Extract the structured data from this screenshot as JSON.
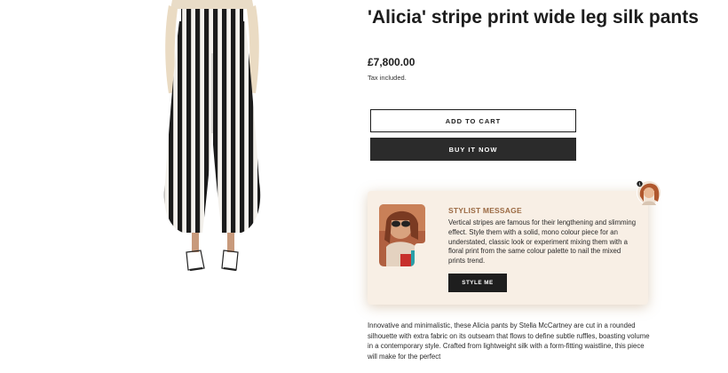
{
  "product": {
    "title": "'Alicia' stripe print wide leg silk pants",
    "price": "£7,800.00",
    "tax_note": "Tax included.",
    "add_to_cart_label": "ADD TO CART",
    "buy_now_label": "BUY IT NOW",
    "image_icon": "product-photo",
    "description": "Innovative and minimalistic, these Alicia pants by Stella McCartney are cut in a rounded silhouette with extra fabric on its outseam that flows to define subtle ruffles, boasting volume in a contemporary style. Crafted from lightweight silk with a form-fitting waistline, this piece will make for the perfect"
  },
  "stylist": {
    "heading": "STYLIST MESSAGE",
    "message": "Vertical stripes are famous for their lengthening and slimming effect. Style them with a solid, mono colour piece for an understated, classic look or experiment mixing them with a floral print from the same colour palette to nail the mixed prints trend.",
    "button_label": "STYLE ME",
    "notification_count": "1",
    "accent_color": "#9b6a43",
    "card_color": "#f8efe5"
  }
}
